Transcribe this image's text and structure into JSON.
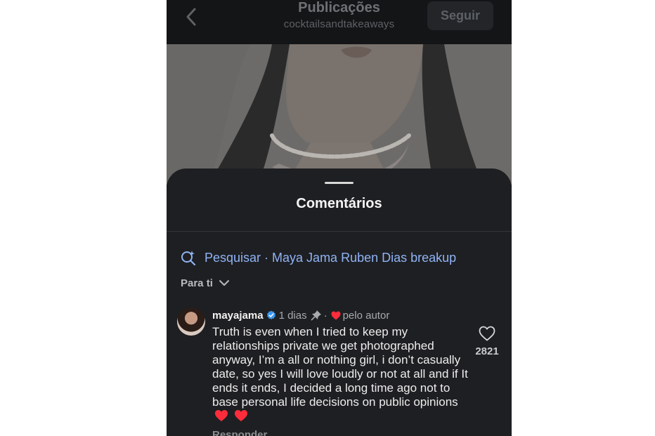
{
  "nav": {
    "title": "Publicações",
    "subtitle": "cocktailsandtakeaways",
    "follow_label": "Seguir",
    "back_icon": "chevron-left-icon"
  },
  "sheet": {
    "title": "Comentários",
    "search": {
      "icon": "search-sparkle-icon",
      "label": "Pesquisar · Maya Jama Ruben Dias breakup",
      "color": "#8fb3f5"
    },
    "sort": {
      "label": "Para ti",
      "icon": "chevron-down-icon"
    }
  },
  "comment": {
    "username": "mayajama",
    "verified_icon": "verified-badge-icon",
    "time": "1 dias",
    "pin_icon": "pin-icon",
    "separator": "·",
    "author_like_icon": "red-heart-icon",
    "author_like_label": "pelo autor",
    "text": "Truth is even when I tried to keep my relationships private we get photographed anyway, I’m a all or nothing girl, i don’t casually date, so yes I will love loudly or not at all and if It ends it ends, I decided a long time ago not to base personal life decisions on public opinions",
    "text_emojis": "❤️ ❤️",
    "like_count": "2821",
    "like_icon": "heart-outline-icon",
    "reply_label": "Responder"
  },
  "colors": {
    "background": "#1e1f22",
    "accent_link": "#8fb3f5",
    "heart_red": "#ff2d3b",
    "verified_blue": "#3897f0"
  }
}
